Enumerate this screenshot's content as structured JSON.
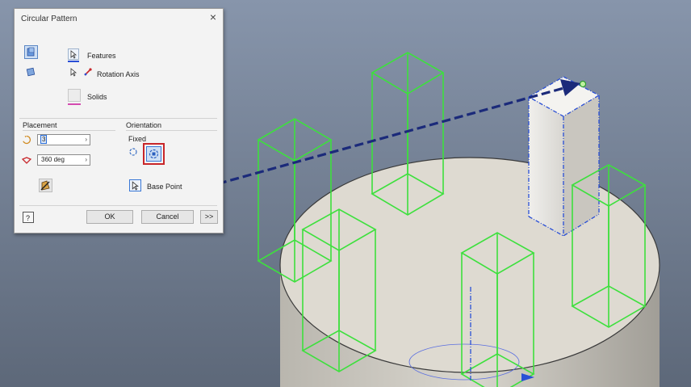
{
  "dialog": {
    "title": "Circular Pattern",
    "close_glyph": "×",
    "selectors": {
      "features_label": "Features",
      "rotation_axis_label": "Rotation Axis",
      "solids_label": "Solids"
    },
    "placement": {
      "section_label": "Placement",
      "count_value": "3",
      "angle_value": "360 deg",
      "spin_arrow": "›"
    },
    "orientation": {
      "section_label": "Orientation",
      "fixed_label": "Fixed",
      "base_point_label": "Base Point"
    },
    "buttons": {
      "ok": "OK",
      "cancel": "Cancel",
      "more": ">>"
    }
  },
  "colors": {
    "wireframe": "#3de03d",
    "selection": "#2a4fd6",
    "highlight_box": "#c8262a",
    "arrow": "#1b2a7a",
    "background_top": "#8795ab",
    "background_bottom": "#5c6779"
  }
}
